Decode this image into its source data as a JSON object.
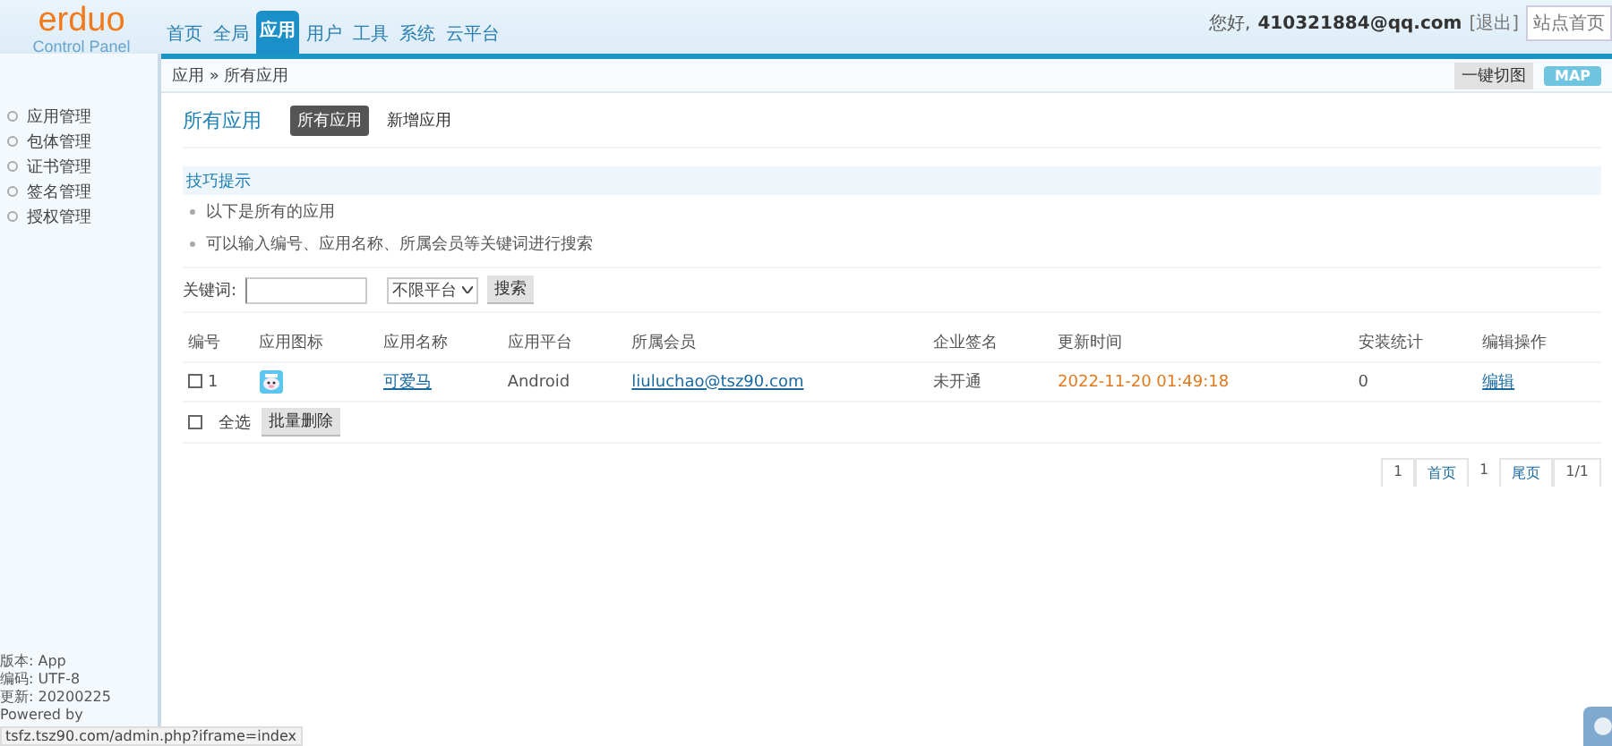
{
  "logo": {
    "name": "erduo",
    "subtitle": "Control Panel"
  },
  "nav": [
    {
      "label": "首页",
      "selected": false
    },
    {
      "label": "全局",
      "selected": false
    },
    {
      "label": "应用",
      "selected": true
    },
    {
      "label": "用户",
      "selected": false
    },
    {
      "label": "工具",
      "selected": false
    },
    {
      "label": "系统",
      "selected": false
    },
    {
      "label": "云平台",
      "selected": false
    }
  ],
  "user": {
    "greeting": "您好,",
    "email": "410321884@qq.com",
    "logout": "[退出]",
    "site_link": "站点首页"
  },
  "breadcrumb": "应用 » 所有应用",
  "toolbar": {
    "cut_button": "一键切图",
    "map_button": "MAP"
  },
  "sidebar": {
    "items": [
      {
        "label": "应用管理"
      },
      {
        "label": "包体管理"
      },
      {
        "label": "证书管理"
      },
      {
        "label": "签名管理"
      },
      {
        "label": "授权管理"
      }
    ],
    "info": [
      "版本: App",
      "编码: UTF-8",
      "更新: 20200225",
      "Powered by"
    ]
  },
  "page_title": "所有应用",
  "tabs": [
    {
      "label": "所有应用",
      "selected": true
    },
    {
      "label": "新增应用",
      "selected": false
    }
  ],
  "tips": {
    "title": "技巧提示",
    "items": [
      "以下是所有的应用",
      "可以输入编号、应用名称、所属会员等关键词进行搜索"
    ]
  },
  "search": {
    "label": "关键词:",
    "platform": "不限平台",
    "button": "搜索"
  },
  "table": {
    "columns": [
      "编号",
      "应用图标",
      "应用名称",
      "应用平台",
      "所属会员",
      "企业签名",
      "更新时间",
      "安装统计",
      "编辑操作"
    ],
    "rows": [
      {
        "checked": false,
        "id": "1",
        "name": "可爱马",
        "platform": "Android",
        "member": "liuluchao@tsz90.com",
        "signature": "未开通",
        "updated": "2022-11-20 01:49:18",
        "installs": "0",
        "action": "编辑"
      }
    ]
  },
  "bulk": {
    "select_all": "全选",
    "select_all_checked": false,
    "delete_button": "批量删除"
  },
  "pagination": [
    {
      "label": "1",
      "kind": "text"
    },
    {
      "label": "首页",
      "kind": "link"
    },
    {
      "label": "1",
      "kind": "current"
    },
    {
      "label": "尾页",
      "kind": "link"
    },
    {
      "label": "1/1",
      "kind": "text"
    }
  ],
  "status_url": "tsfz.tsz90.com/admin.php?iframe=index"
}
